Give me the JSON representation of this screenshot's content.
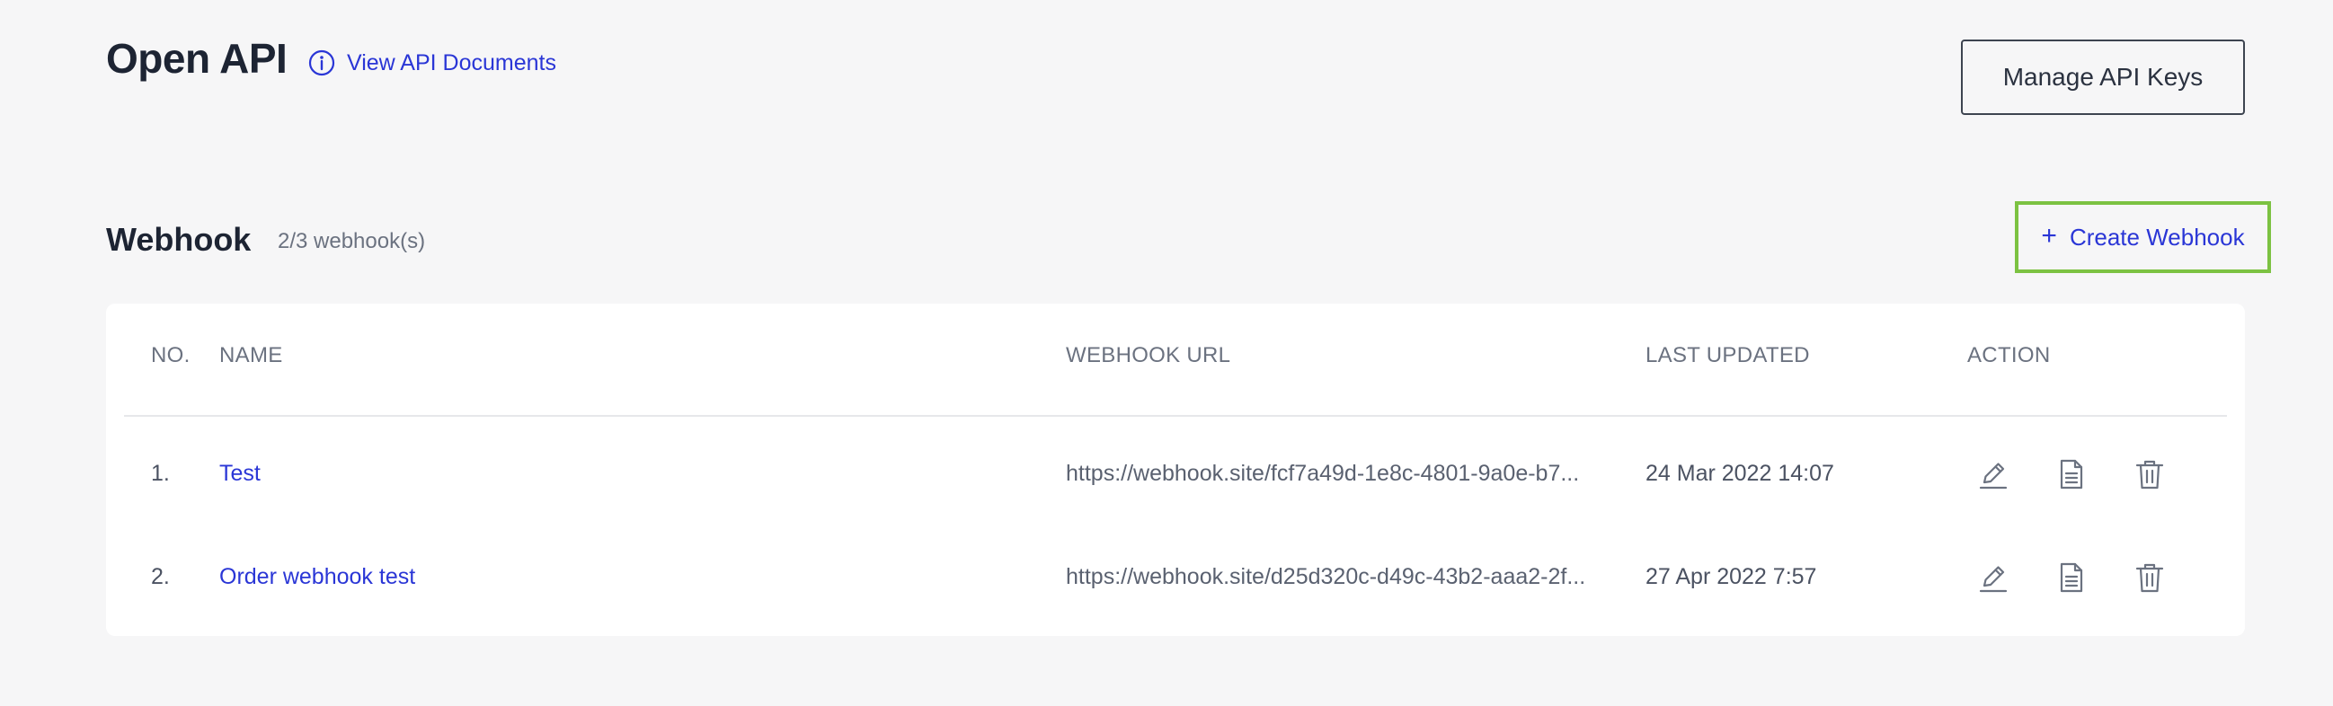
{
  "header": {
    "title": "Open API",
    "docs_link": "View API Documents",
    "manage_keys_button": "Manage API Keys"
  },
  "webhook": {
    "title": "Webhook",
    "count": "2/3 webhook(s)",
    "create_button": "Create Webhook",
    "columns": [
      "NO.",
      "NAME",
      "WEBHOOK URL",
      "LAST UPDATED",
      "ACTION"
    ],
    "rows": [
      {
        "no": "1.",
        "name": "Test",
        "url": "https://webhook.site/fcf7a49d-1e8c-4801-9a0e-b7...",
        "last_updated": "24 Mar 2022 14:07",
        "actions": [
          "edit-icon",
          "document-icon",
          "trash-icon"
        ]
      },
      {
        "no": "2.",
        "name": "Order webhook test",
        "url": "https://webhook.site/d25d320c-d49c-43b2-aaa2-2f...",
        "last_updated": "27 Apr 2022 7:57",
        "actions": [
          "edit-icon",
          "document-icon",
          "trash-icon"
        ]
      }
    ]
  },
  "colors": {
    "background": "#f6f6f7",
    "link": "#2a36d6",
    "highlight_border": "#7cc242",
    "muted_text": "#6b7280"
  }
}
